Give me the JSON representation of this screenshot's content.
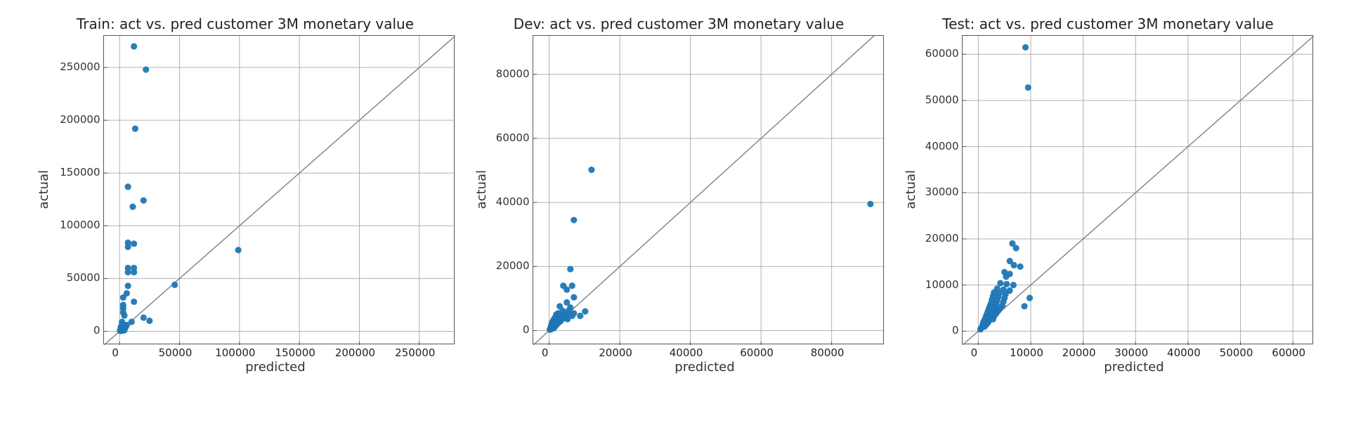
{
  "xlabel": "predicted",
  "ylabel": "actual",
  "point_color": "#1f77b4",
  "chart_data": [
    {
      "type": "scatter",
      "title": "Train: act vs. pred customer 3M monetary value",
      "xlabel": "predicted",
      "ylabel": "actual",
      "xlim": [
        -13000,
        280000
      ],
      "ylim": [
        -13000,
        280000
      ],
      "xticks": [
        0,
        50000,
        100000,
        150000,
        200000,
        250000
      ],
      "yticks": [
        0,
        50000,
        100000,
        150000,
        200000,
        250000
      ],
      "diagonal": true,
      "series": [
        {
          "name": "train",
          "points": [
            [
              12000,
              270000
            ],
            [
              22000,
              248000
            ],
            [
              13000,
              192000
            ],
            [
              7000,
              137000
            ],
            [
              20000,
              124000
            ],
            [
              11000,
              118000
            ],
            [
              7000,
              84000
            ],
            [
              12000,
              83000
            ],
            [
              7000,
              80000
            ],
            [
              99000,
              77000
            ],
            [
              7000,
              60000
            ],
            [
              12000,
              60000
            ],
            [
              7000,
              56000
            ],
            [
              12000,
              56000
            ],
            [
              46000,
              44000
            ],
            [
              7000,
              43000
            ],
            [
              6000,
              36000
            ],
            [
              3000,
              32000
            ],
            [
              12000,
              28000
            ],
            [
              3000,
              25000
            ],
            [
              3000,
              22000
            ],
            [
              3000,
              18000
            ],
            [
              4000,
              15000
            ],
            [
              20000,
              13000
            ],
            [
              25000,
              10000
            ],
            [
              2000,
              9000
            ],
            [
              10000,
              9000
            ],
            [
              2000,
              6000
            ],
            [
              4000,
              6000
            ],
            [
              6000,
              6000
            ],
            [
              1000,
              4000
            ],
            [
              3000,
              4000
            ],
            [
              5000,
              4000
            ],
            [
              1000,
              2000
            ],
            [
              3000,
              2000
            ],
            [
              500,
              1000
            ],
            [
              2000,
              1000
            ],
            [
              4000,
              1000
            ],
            [
              500,
              500
            ],
            [
              1500,
              500
            ]
          ]
        }
      ]
    },
    {
      "type": "scatter",
      "title": "Dev: act vs. pred customer 3M monetary value",
      "xlabel": "predicted",
      "ylabel": "actual",
      "xlim": [
        -4500,
        95000
      ],
      "ylim": [
        -4500,
        92000
      ],
      "xticks": [
        0,
        20000,
        40000,
        60000,
        80000
      ],
      "yticks": [
        0,
        20000,
        40000,
        60000,
        80000
      ],
      "diagonal": true,
      "series": [
        {
          "name": "dev",
          "points": [
            [
              12000,
              50200
            ],
            [
              91000,
              39500
            ],
            [
              7000,
              34500
            ],
            [
              6000,
              19200
            ],
            [
              4000,
              14000
            ],
            [
              6500,
              14000
            ],
            [
              5000,
              12800
            ],
            [
              7000,
              10400
            ],
            [
              5000,
              8800
            ],
            [
              3000,
              7600
            ],
            [
              6000,
              7200
            ],
            [
              3800,
              6200
            ],
            [
              5500,
              6200
            ],
            [
              10200,
              6000
            ],
            [
              2500,
              5400
            ],
            [
              4500,
              5400
            ],
            [
              7000,
              5400
            ],
            [
              2000,
              5000
            ],
            [
              3600,
              5000
            ],
            [
              5400,
              5000
            ],
            [
              6500,
              4600
            ],
            [
              8800,
              4600
            ],
            [
              1800,
              4200
            ],
            [
              3000,
              4200
            ],
            [
              4600,
              4200
            ],
            [
              1500,
              3800
            ],
            [
              2800,
              3800
            ],
            [
              3900,
              3800
            ],
            [
              5200,
              3600
            ],
            [
              1200,
              3200
            ],
            [
              2200,
              3200
            ],
            [
              3400,
              3200
            ],
            [
              1000,
              2800
            ],
            [
              2000,
              2800
            ],
            [
              3000,
              2800
            ],
            [
              800,
              2400
            ],
            [
              1800,
              2400
            ],
            [
              2600,
              2400
            ],
            [
              700,
              2000
            ],
            [
              1500,
              2000
            ],
            [
              2200,
              2000
            ],
            [
              600,
              1600
            ],
            [
              1300,
              1600
            ],
            [
              1900,
              1600
            ],
            [
              500,
              1200
            ],
            [
              1100,
              1200
            ],
            [
              1600,
              1200
            ],
            [
              400,
              800
            ],
            [
              900,
              800
            ],
            [
              1300,
              800
            ],
            [
              300,
              500
            ],
            [
              700,
              500
            ],
            [
              200,
              300
            ]
          ]
        }
      ]
    },
    {
      "type": "scatter",
      "title": "Test: act vs. pred customer 3M monetary value",
      "xlabel": "predicted",
      "ylabel": "actual",
      "xlim": [
        -3000,
        64000
      ],
      "ylim": [
        -3000,
        64000
      ],
      "xticks": [
        0,
        10000,
        20000,
        30000,
        40000,
        50000,
        60000
      ],
      "yticks": [
        0,
        10000,
        20000,
        30000,
        40000,
        50000,
        60000
      ],
      "diagonal": true,
      "series": [
        {
          "name": "test",
          "points": [
            [
              9000,
              61500
            ],
            [
              9500,
              52800
            ],
            [
              6500,
              19000
            ],
            [
              7200,
              18000
            ],
            [
              6000,
              15200
            ],
            [
              6800,
              14300
            ],
            [
              8000,
              14000
            ],
            [
              5000,
              12800
            ],
            [
              6000,
              12400
            ],
            [
              5300,
              11800
            ],
            [
              4200,
              10400
            ],
            [
              5400,
              10200
            ],
            [
              6700,
              10000
            ],
            [
              3600,
              9200
            ],
            [
              4800,
              9000
            ],
            [
              6000,
              8800
            ],
            [
              3000,
              8400
            ],
            [
              4000,
              8200
            ],
            [
              5200,
              8000
            ],
            [
              2800,
              7600
            ],
            [
              9800,
              7200
            ],
            [
              3800,
              7400
            ],
            [
              5000,
              7200
            ],
            [
              2600,
              6800
            ],
            [
              3600,
              6600
            ],
            [
              4800,
              6400
            ],
            [
              2400,
              6000
            ],
            [
              3400,
              5800
            ],
            [
              4600,
              5600
            ],
            [
              8800,
              5400
            ],
            [
              2200,
              5400
            ],
            [
              3200,
              5200
            ],
            [
              4200,
              5000
            ],
            [
              2000,
              4800
            ],
            [
              3000,
              4600
            ],
            [
              3800,
              4400
            ],
            [
              1800,
              4200
            ],
            [
              2600,
              4000
            ],
            [
              3400,
              3800
            ],
            [
              1600,
              3600
            ],
            [
              2400,
              3400
            ],
            [
              3000,
              3200
            ],
            [
              1400,
              3000
            ],
            [
              2200,
              2800
            ],
            [
              2800,
              2600
            ],
            [
              1200,
              2400
            ],
            [
              2000,
              2200
            ],
            [
              1000,
              2000
            ],
            [
              1800,
              1800
            ],
            [
              900,
              1600
            ],
            [
              1500,
              1400
            ],
            [
              800,
              1200
            ],
            [
              1200,
              1000
            ],
            [
              700,
              800
            ],
            [
              500,
              600
            ],
            [
              400,
              400
            ]
          ]
        }
      ]
    }
  ]
}
